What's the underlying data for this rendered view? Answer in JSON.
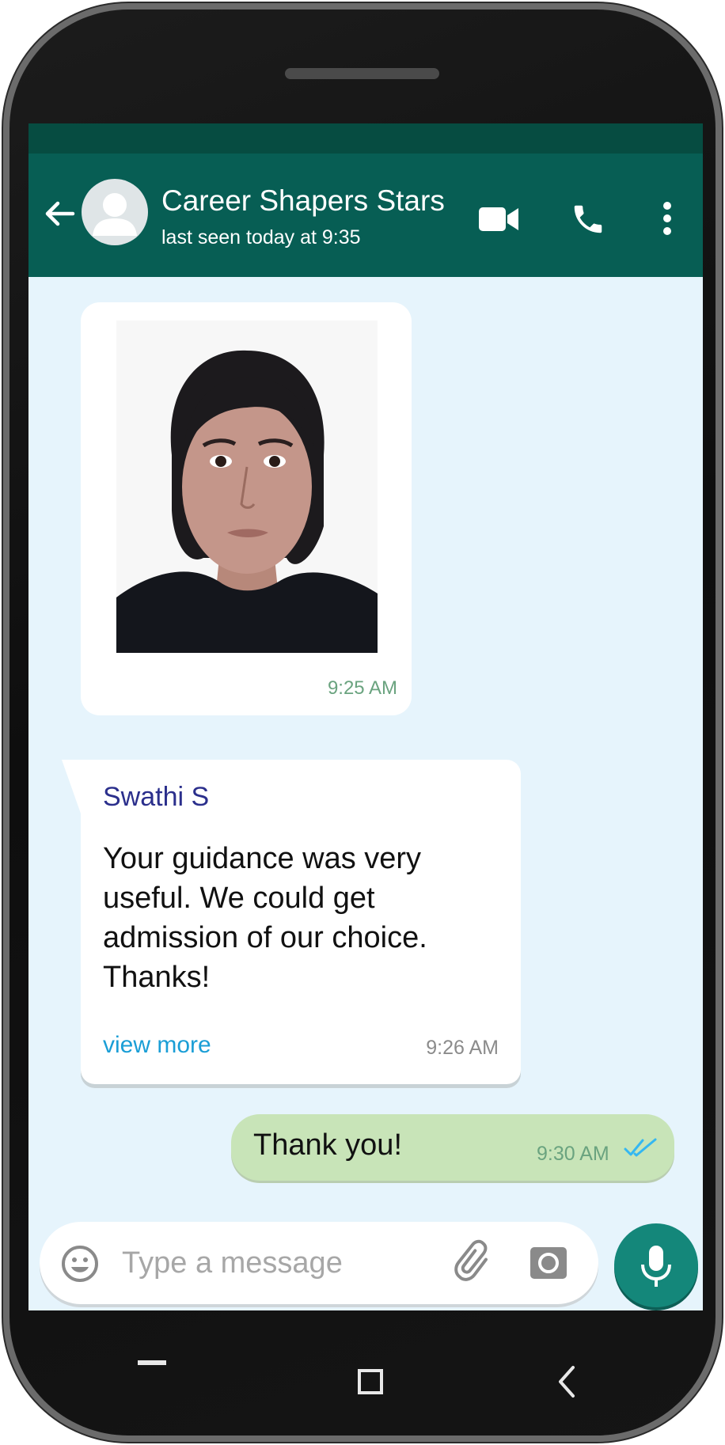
{
  "header": {
    "chat_name": "Career Shapers Stars",
    "last_seen": "last seen today at 9:35"
  },
  "messages": [
    {
      "type": "image",
      "time": "9:25 AM"
    },
    {
      "type": "text",
      "sender": "Swathi S",
      "text": "Your guidance was very useful. We could get admission of our choice. Thanks!",
      "link": "view more",
      "time": "9:26 AM"
    },
    {
      "type": "outgoing",
      "text": "Thank you!",
      "time": "9:30 AM",
      "status": "read"
    }
  ],
  "composer": {
    "placeholder": "Type a message"
  },
  "colors": {
    "header": "#075e54",
    "status_bar": "#064c41",
    "chat_background": "#e6f4fc",
    "outgoing_bubble": "#c8e4b8",
    "mic_button": "#14877a",
    "read_ticks": "#34b7f1"
  },
  "icons": [
    "back-arrow-icon",
    "avatar",
    "video-camera-icon",
    "phone-icon",
    "more-vert-icon",
    "emoji-icon",
    "paperclip-icon",
    "camera-icon",
    "mic-icon",
    "read-ticks-icon",
    "nav-recent-icon",
    "nav-home-icon",
    "nav-back-icon"
  ]
}
